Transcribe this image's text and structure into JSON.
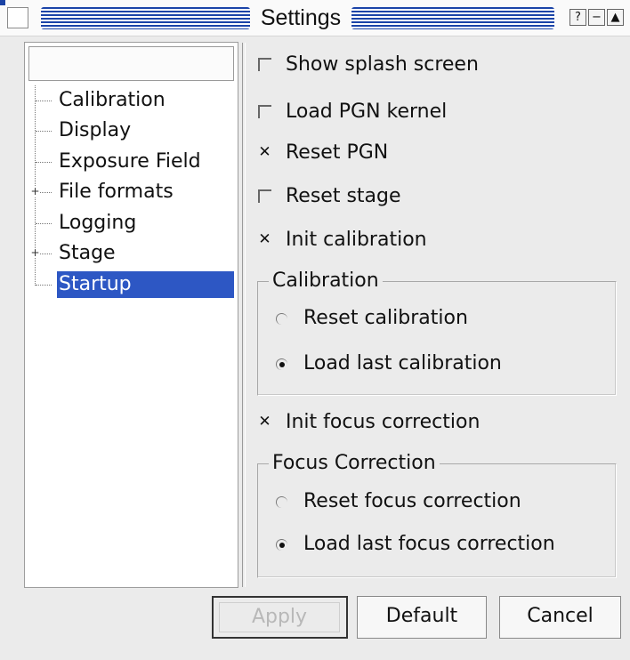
{
  "window": {
    "title": "Settings",
    "help_button_label": "?",
    "minimize_button_label": "−",
    "maximize_button_label": "▲"
  },
  "sidebar": {
    "items": [
      {
        "label": "Calibration",
        "expandable": false,
        "selected": false
      },
      {
        "label": "Display",
        "expandable": false,
        "selected": false
      },
      {
        "label": "Exposure Field",
        "expandable": false,
        "selected": false
      },
      {
        "label": "File formats",
        "expandable": true,
        "selected": false
      },
      {
        "label": "Logging",
        "expandable": false,
        "selected": false
      },
      {
        "label": "Stage",
        "expandable": true,
        "selected": false
      },
      {
        "label": "Startup",
        "expandable": false,
        "selected": true
      }
    ]
  },
  "startup": {
    "show_splash": {
      "label": "Show splash screen",
      "checked": false
    },
    "load_pgn_kernel": {
      "label": "Load PGN kernel",
      "checked": false
    },
    "reset_pgn": {
      "label": "Reset PGN",
      "checked": true
    },
    "reset_stage": {
      "label": "Reset stage",
      "checked": false
    },
    "init_calibration": {
      "label": "Init calibration",
      "checked": true
    },
    "calibration_group": {
      "title": "Calibration",
      "options": [
        {
          "label": "Reset calibration",
          "selected": false
        },
        {
          "label": "Load last calibration",
          "selected": true
        }
      ]
    },
    "init_focus_correction": {
      "label": "Init focus correction",
      "checked": true
    },
    "focus_group": {
      "title": "Focus Correction",
      "options": [
        {
          "label": "Reset focus correction",
          "selected": false
        },
        {
          "label": "Load last focus correction",
          "selected": true
        }
      ]
    }
  },
  "buttons": {
    "apply_label": "Apply",
    "default_label": "Default",
    "cancel_label": "Cancel"
  },
  "icons": {
    "checked_mark": "✕",
    "expand_mark": "+"
  }
}
